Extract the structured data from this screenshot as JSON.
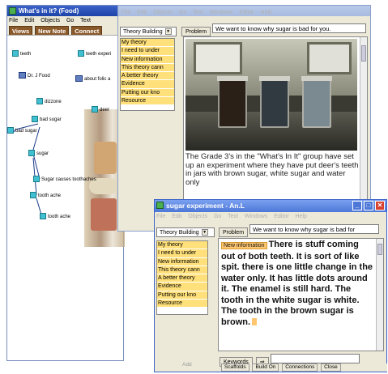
{
  "back_window": {
    "title": "What's in it? (Food)",
    "menu": [
      "File",
      "Edit",
      "Objects",
      "Go",
      "Text"
    ],
    "toolbar": [
      "Views",
      "New Note",
      "Connect"
    ],
    "nodes": [
      "teeth",
      "teeth experi",
      "Dr. J Food",
      "about folic a",
      "dizzone",
      "deer",
      "bad sugar",
      "bad sugar",
      "sugar",
      "Sugar causes toothaches",
      "tooth ache",
      "tooth ache"
    ]
  },
  "middle_window": {
    "menu": [
      "File",
      "Edit",
      "Objects",
      "Go",
      "Text",
      "Windows",
      "Editor",
      "Help"
    ],
    "scaffold_select": "Theory Building",
    "problem_label": "Problem",
    "problem_text": "We want to know why sugar is bad for you.",
    "scaffolds": [
      "My theory",
      "I need to under",
      "New information",
      "This theory cann",
      "A better theory",
      "Evidence",
      "Putting our kno",
      "Resource"
    ],
    "body_text": "The Grade 3's in the \"What's In It\" group have set up an experiment where they have put deer's teeth in jars with brown sugar, white sugar and water only"
  },
  "front_window": {
    "title": "sugar experiment - An.L",
    "menu": [
      "File",
      "Edit",
      "Objects",
      "Go",
      "Text",
      "Windows",
      "Editor",
      "Help"
    ],
    "scaffold_select": "Theory Building",
    "problem_label": "Problem",
    "problem_text": "We want to know why sugar is bad for",
    "scaffolds": [
      "My theory",
      "I need to under",
      "New information",
      "This theory cann",
      "A better theory",
      "Evidence",
      "Putting our kno",
      "Resource"
    ],
    "tag": "New information",
    "body_text": "There is stuff coming out of both teeth. It is sort of like spit. there is one little change in the water only. It has little dots around it. The enamel is still hard. The tooth in the white sugar is white. The tooth in the brown sugar is brown.",
    "keywords_label": "Keywords",
    "add_label": "Add",
    "status": [
      "Scaffolds",
      "Build On",
      "Connections",
      "Close"
    ]
  }
}
